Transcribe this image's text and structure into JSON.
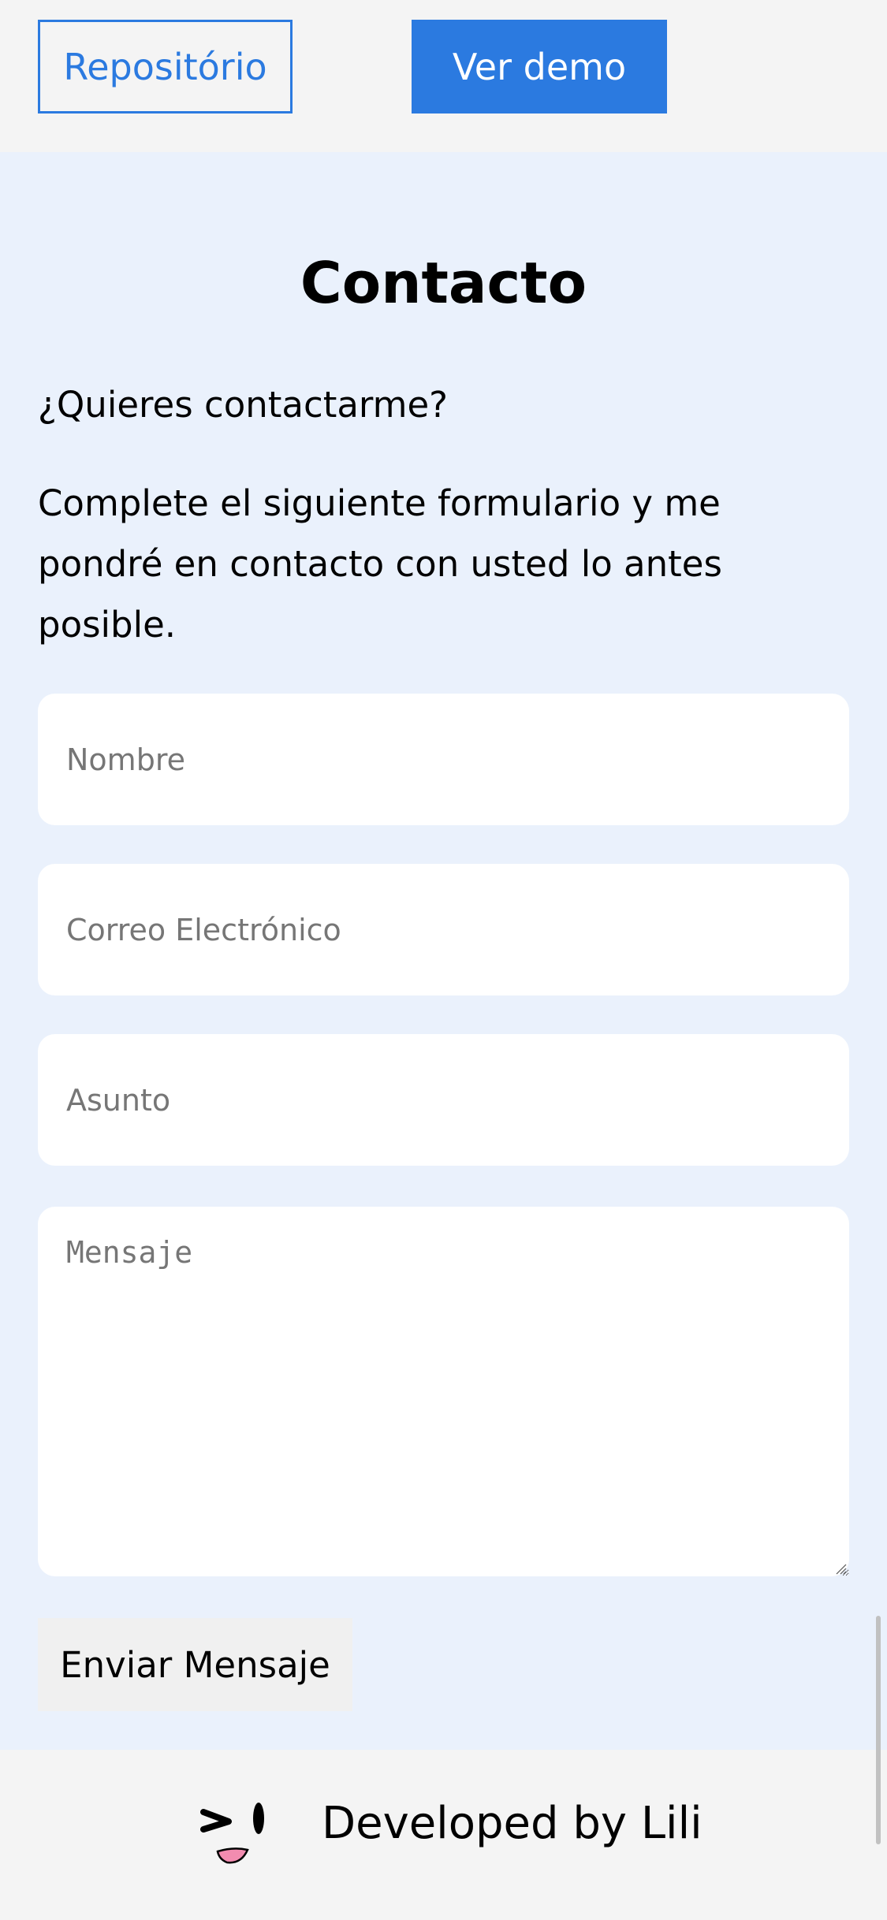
{
  "project_actions": {
    "repository_label": "Repositório",
    "demo_label": "Ver demo",
    "accent_color": "#2b7ae0"
  },
  "contact": {
    "title": "Contacto",
    "question": "¿Quieres contactarme?",
    "description": "Complete el siguiente formulario y me pondré en contacto con usted lo antes posible.",
    "form": {
      "name_placeholder": "Nombre",
      "name_value": "",
      "email_placeholder": "Correo Electrónico",
      "email_value": "",
      "subject_placeholder": "Asunto",
      "subject_value": "",
      "message_placeholder": "Mensaje",
      "message_value": "",
      "submit_label": "Enviar Mensaje"
    },
    "background_color": "#eaf1fc"
  },
  "footer": {
    "credit_text": "Developed by Lili",
    "logo_icon": "winking-face-icon"
  }
}
